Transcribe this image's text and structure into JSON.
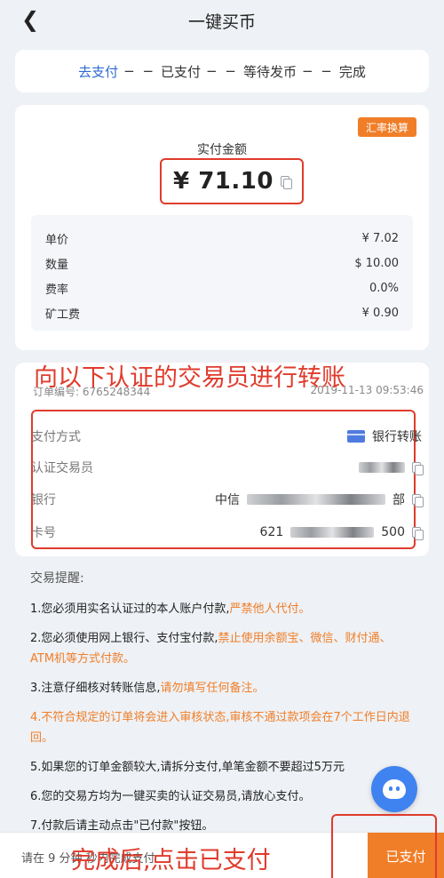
{
  "header": {
    "back_icon": "chevron-left-icon",
    "title": "一键买币"
  },
  "steps": [
    {
      "label": "去支付",
      "active": true
    },
    {
      "label": "已支付",
      "active": false
    },
    {
      "label": "等待发币",
      "active": false
    },
    {
      "label": "完成",
      "active": false
    }
  ],
  "step_separator": "− −",
  "amount": {
    "rate_badge": "汇率换算",
    "label": "实付金额",
    "value": "¥ 71.10"
  },
  "fees": [
    {
      "label": "单价",
      "value": "¥ 7.02"
    },
    {
      "label": "数量",
      "value": "$ 10.00"
    },
    {
      "label": "费率",
      "value": "0.0%"
    },
    {
      "label": "矿工费",
      "value": "¥ 0.90"
    }
  ],
  "annotation_top": "向以下认证的交易员进行转账",
  "order": {
    "id": "订单编号: 6765248344",
    "time": "2019-11-13 09:53:46"
  },
  "trader": {
    "pay_method_label": "支付方式",
    "pay_method_value": "银行转账",
    "trader_label": "认证交易员",
    "bank_label": "银行",
    "bank_prefix": "中信",
    "bank_suffix": "部",
    "card_label": "卡号",
    "card_prefix": "621",
    "card_suffix": "500"
  },
  "notice": {
    "title": "交易提醒:",
    "items": [
      {
        "text": "1.您必须用实名认证过的本人账户付款,",
        "warn": "严禁他人代付。"
      },
      {
        "text": "2.您必须使用网上银行、支付宝付款,",
        "warn": "禁止使用余额宝、微信、财付通、ATM机等方式付款。"
      },
      {
        "text": "3.注意仔细核对转账信息,",
        "warn": "请勿填写任何备注。"
      },
      {
        "text": "",
        "warn": "4.不符合规定的订单将会进入审核状态,审核不通过款项会在7个工作日内退回。"
      },
      {
        "text": "5.如果您的订单金额较大,请拆分支付,单笔金额不要超过5万元",
        "warn": ""
      },
      {
        "text": "6.您的交易方均为一键买卖的认证交易员,请放心支付。",
        "warn": ""
      },
      {
        "text": "7.付款后请主动点击\"已付款\"按钮。",
        "warn": ""
      }
    ]
  },
  "support_icon": "customer-service-icon",
  "bottom": {
    "countdown": "请在 9 分钟 秒内完成支付",
    "paid_button": "已支付",
    "annotation": "完成后,点击已支付"
  },
  "colors": {
    "accent": "#f07e28",
    "active_step": "#2f6bd1",
    "annotation": "#e03b2c",
    "support": "#3f83f0"
  }
}
